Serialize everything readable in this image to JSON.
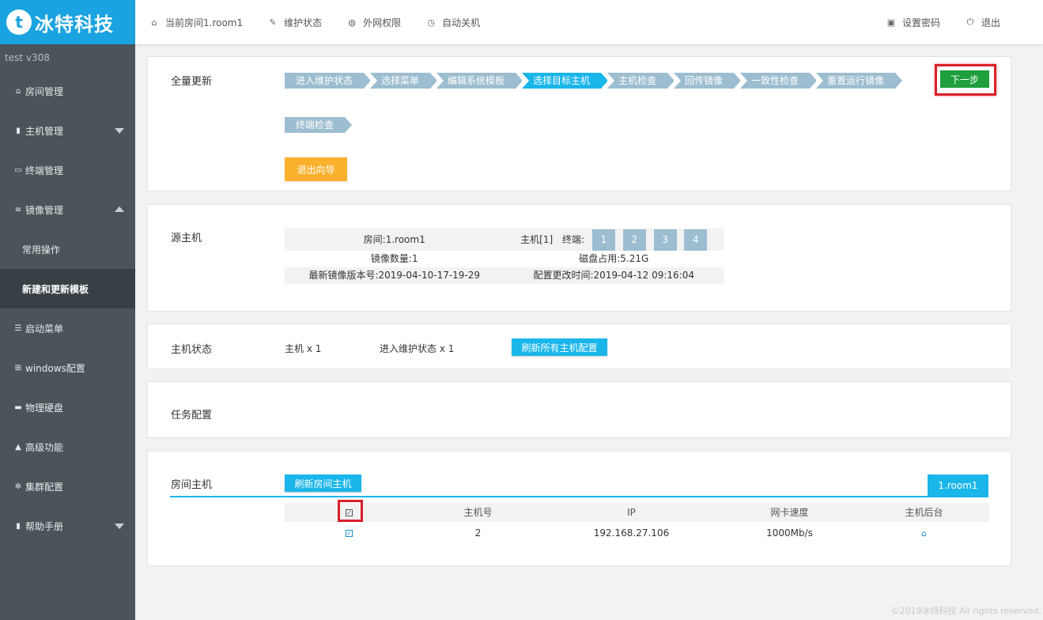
{
  "logo": {
    "mark": "t",
    "text": "冰特科技"
  },
  "topbar": {
    "items": [
      {
        "icon": "home-icon",
        "glyph": "⌂",
        "label": "当前房间1.room1"
      },
      {
        "icon": "wrench-icon",
        "glyph": "✎",
        "label": "维护状态"
      },
      {
        "icon": "globe-icon",
        "glyph": "◍",
        "label": "外网权限"
      },
      {
        "icon": "clock-icon",
        "glyph": "◷",
        "label": "自动关机"
      }
    ],
    "right": [
      {
        "icon": "lock-icon",
        "glyph": "▣",
        "label": "设置密码"
      },
      {
        "icon": "power-icon",
        "glyph": "⏻",
        "label": "退出"
      }
    ]
  },
  "sidebar": {
    "version": "test  v308",
    "items": [
      {
        "label": "房间管理",
        "glyph": "⌂"
      },
      {
        "label": "主机管理",
        "glyph": "▮"
      },
      {
        "label": "终端管理",
        "glyph": "▭"
      },
      {
        "label": "镜像管理",
        "glyph": "≡"
      },
      {
        "label": "常用操作"
      },
      {
        "label": "新建和更新模板"
      },
      {
        "label": "启动菜单",
        "glyph": "☰"
      },
      {
        "label": "windows配置",
        "glyph": "⊞"
      },
      {
        "label": "物理硬盘",
        "glyph": "▬"
      },
      {
        "label": "高级功能",
        "glyph": "▲"
      },
      {
        "label": "集群配置",
        "glyph": "✲"
      },
      {
        "label": "帮助手册",
        "glyph": "▮"
      }
    ]
  },
  "wizard": {
    "title": "全量更新",
    "steps": [
      "进入维护状态",
      "选择菜单",
      "编辑系统模板",
      "选择目标主机",
      "主机检查",
      "回传镜像",
      "一致性检查",
      "重置运行镜像",
      "终端检查"
    ],
    "active_step": 3,
    "next_label": "下一步",
    "exit_label": "退出向导"
  },
  "source": {
    "title": "源主机",
    "room": "房间:1.room1",
    "host": "主机[1]",
    "terminal_label": "终端:",
    "terminals": [
      "1",
      "2",
      "3",
      "4"
    ],
    "image_count": "镜像数量:1",
    "disk_usage": "磁盘占用:5.21G",
    "latest_version": "最新镜像版本号:2019-04-10-17-19-29",
    "config_time": "配置更改时间:2019-04-12 09:16:04"
  },
  "host_status": {
    "title": "主机状态",
    "hosts": "主机 x 1",
    "maintenance": "进入维护状态 x 1",
    "refresh_label": "刷新所有主机配置"
  },
  "task": {
    "title": "任务配置"
  },
  "room_hosts": {
    "title": "房间主机",
    "refresh_label": "刷新房间主机",
    "tab_label": "1.room1",
    "headers": {
      "host_no": "主机号",
      "ip": "IP",
      "nic": "网卡速度",
      "backend": "主机后台"
    },
    "rows": [
      {
        "host_no": "2",
        "ip": "192.168.27.106",
        "nic": "1000Mb/s"
      }
    ]
  },
  "footer": "©2019冰特科技 All rights reserved."
}
